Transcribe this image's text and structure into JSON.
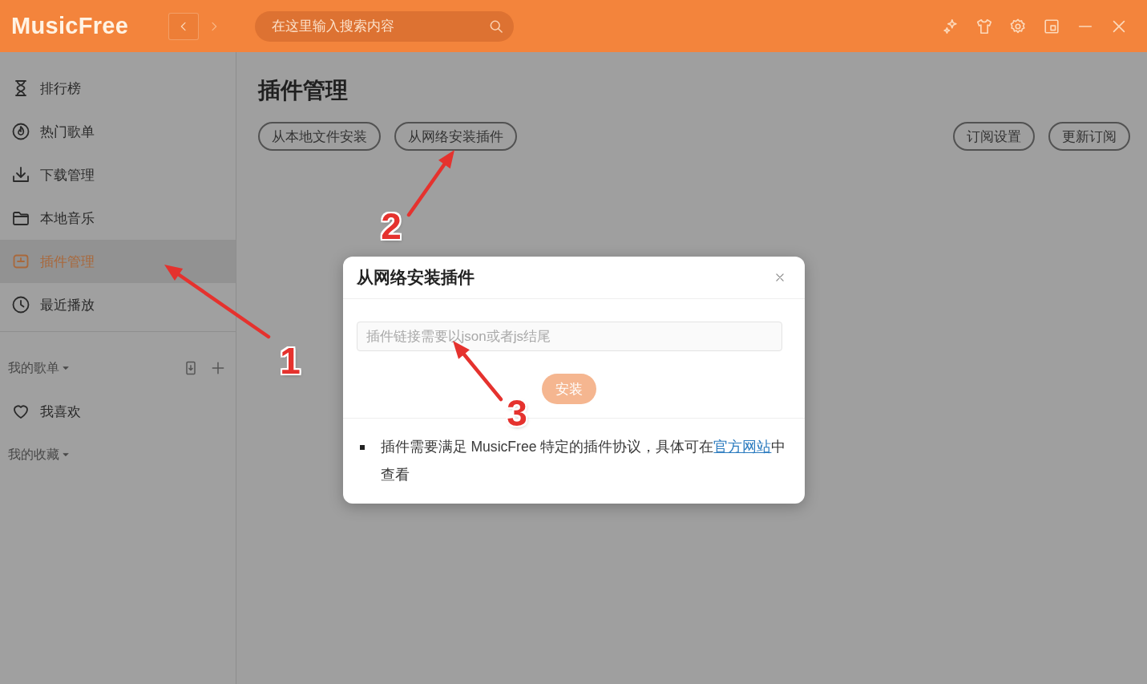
{
  "title_bar": {
    "logo": "MusicFree",
    "search": {
      "placeholder": "在这里输入搜索内容"
    }
  },
  "sidebar": {
    "items": [
      {
        "label": "排行榜",
        "selected": false
      },
      {
        "label": "热门歌单",
        "selected": false
      },
      {
        "label": "下载管理",
        "selected": false
      },
      {
        "label": "本地音乐",
        "selected": false
      },
      {
        "label": "插件管理",
        "selected": true
      },
      {
        "label": "最近播放",
        "selected": false
      }
    ],
    "sections": [
      {
        "title": "我的歌单",
        "kind": "editable",
        "items": [
          {
            "label": "我喜欢",
            "selected": false
          }
        ]
      },
      {
        "title": "我的收藏",
        "kind": "plain"
      }
    ]
  },
  "page": {
    "title": "插件管理",
    "left_actions": [
      "从本地文件安装",
      "从网络安装插件"
    ],
    "right_actions": [
      "订阅设置",
      "更新订阅"
    ]
  },
  "dialog": {
    "title": "从网络安装插件",
    "input": {
      "placeholder": "插件链接需要以json或者js结尾"
    },
    "install_button": {
      "label": "安装",
      "disabled": true
    },
    "note": {
      "before": "插件需要满足 MusicFree 特定的插件协议，具体可在",
      "link": "官方网站",
      "after": "中查看"
    }
  },
  "annotations": [
    {
      "label": "1"
    },
    {
      "label": "2"
    },
    {
      "label": "3"
    }
  ]
}
